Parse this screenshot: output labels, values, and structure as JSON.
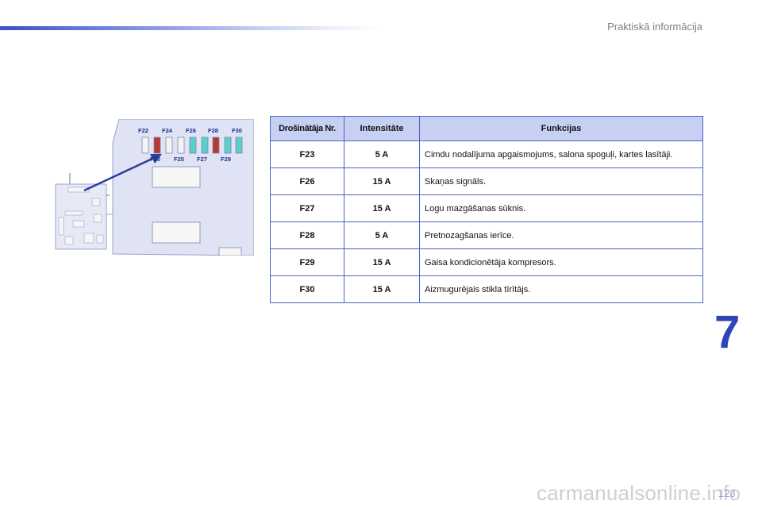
{
  "header": {
    "section_title": "Praktiskā informācija"
  },
  "chapter_number": "7",
  "page_number": "123",
  "watermark": "carmanualsonline.info",
  "diagram": {
    "top_fuse_labels": [
      "F22",
      "F24",
      "F26",
      "F28",
      "F30"
    ],
    "bottom_fuse_labels": [
      "F23",
      "F25",
      "F27",
      "F29"
    ],
    "colors": {
      "box_fill": "#dfe3f4",
      "fuse_white": "#f4f4f4",
      "fuse_red": "#b53a34",
      "fuse_cyan": "#5ad0c8",
      "arrow": "#2a3f9c",
      "label": "#1d2f8f"
    }
  },
  "table": {
    "headers": {
      "fuse_no": "Drošinātāja Nr.",
      "intensity": "Intensitāte",
      "functions": "Funkcijas"
    },
    "rows": [
      {
        "fuse": "F23",
        "amps": "5 A",
        "function": "Cimdu nodalījuma apgaismojums, salona spoguļi, kartes lasītāji."
      },
      {
        "fuse": "F26",
        "amps": "15 A",
        "function": "Skaņas signāls."
      },
      {
        "fuse": "F27",
        "amps": "15 A",
        "function": "Logu mazgāšanas sūknis."
      },
      {
        "fuse": "F28",
        "amps": "5 A",
        "function": "Pretnozagšanas ierīce."
      },
      {
        "fuse": "F29",
        "amps": "15 A",
        "function": "Gaisa kondicionētāja kompresors."
      },
      {
        "fuse": "F30",
        "amps": "15 A",
        "function": "Aizmugurējais stikla tīrītājs."
      }
    ],
    "colors": {
      "header_bg": "#c7d0f2",
      "border": "#4a63c8"
    }
  }
}
